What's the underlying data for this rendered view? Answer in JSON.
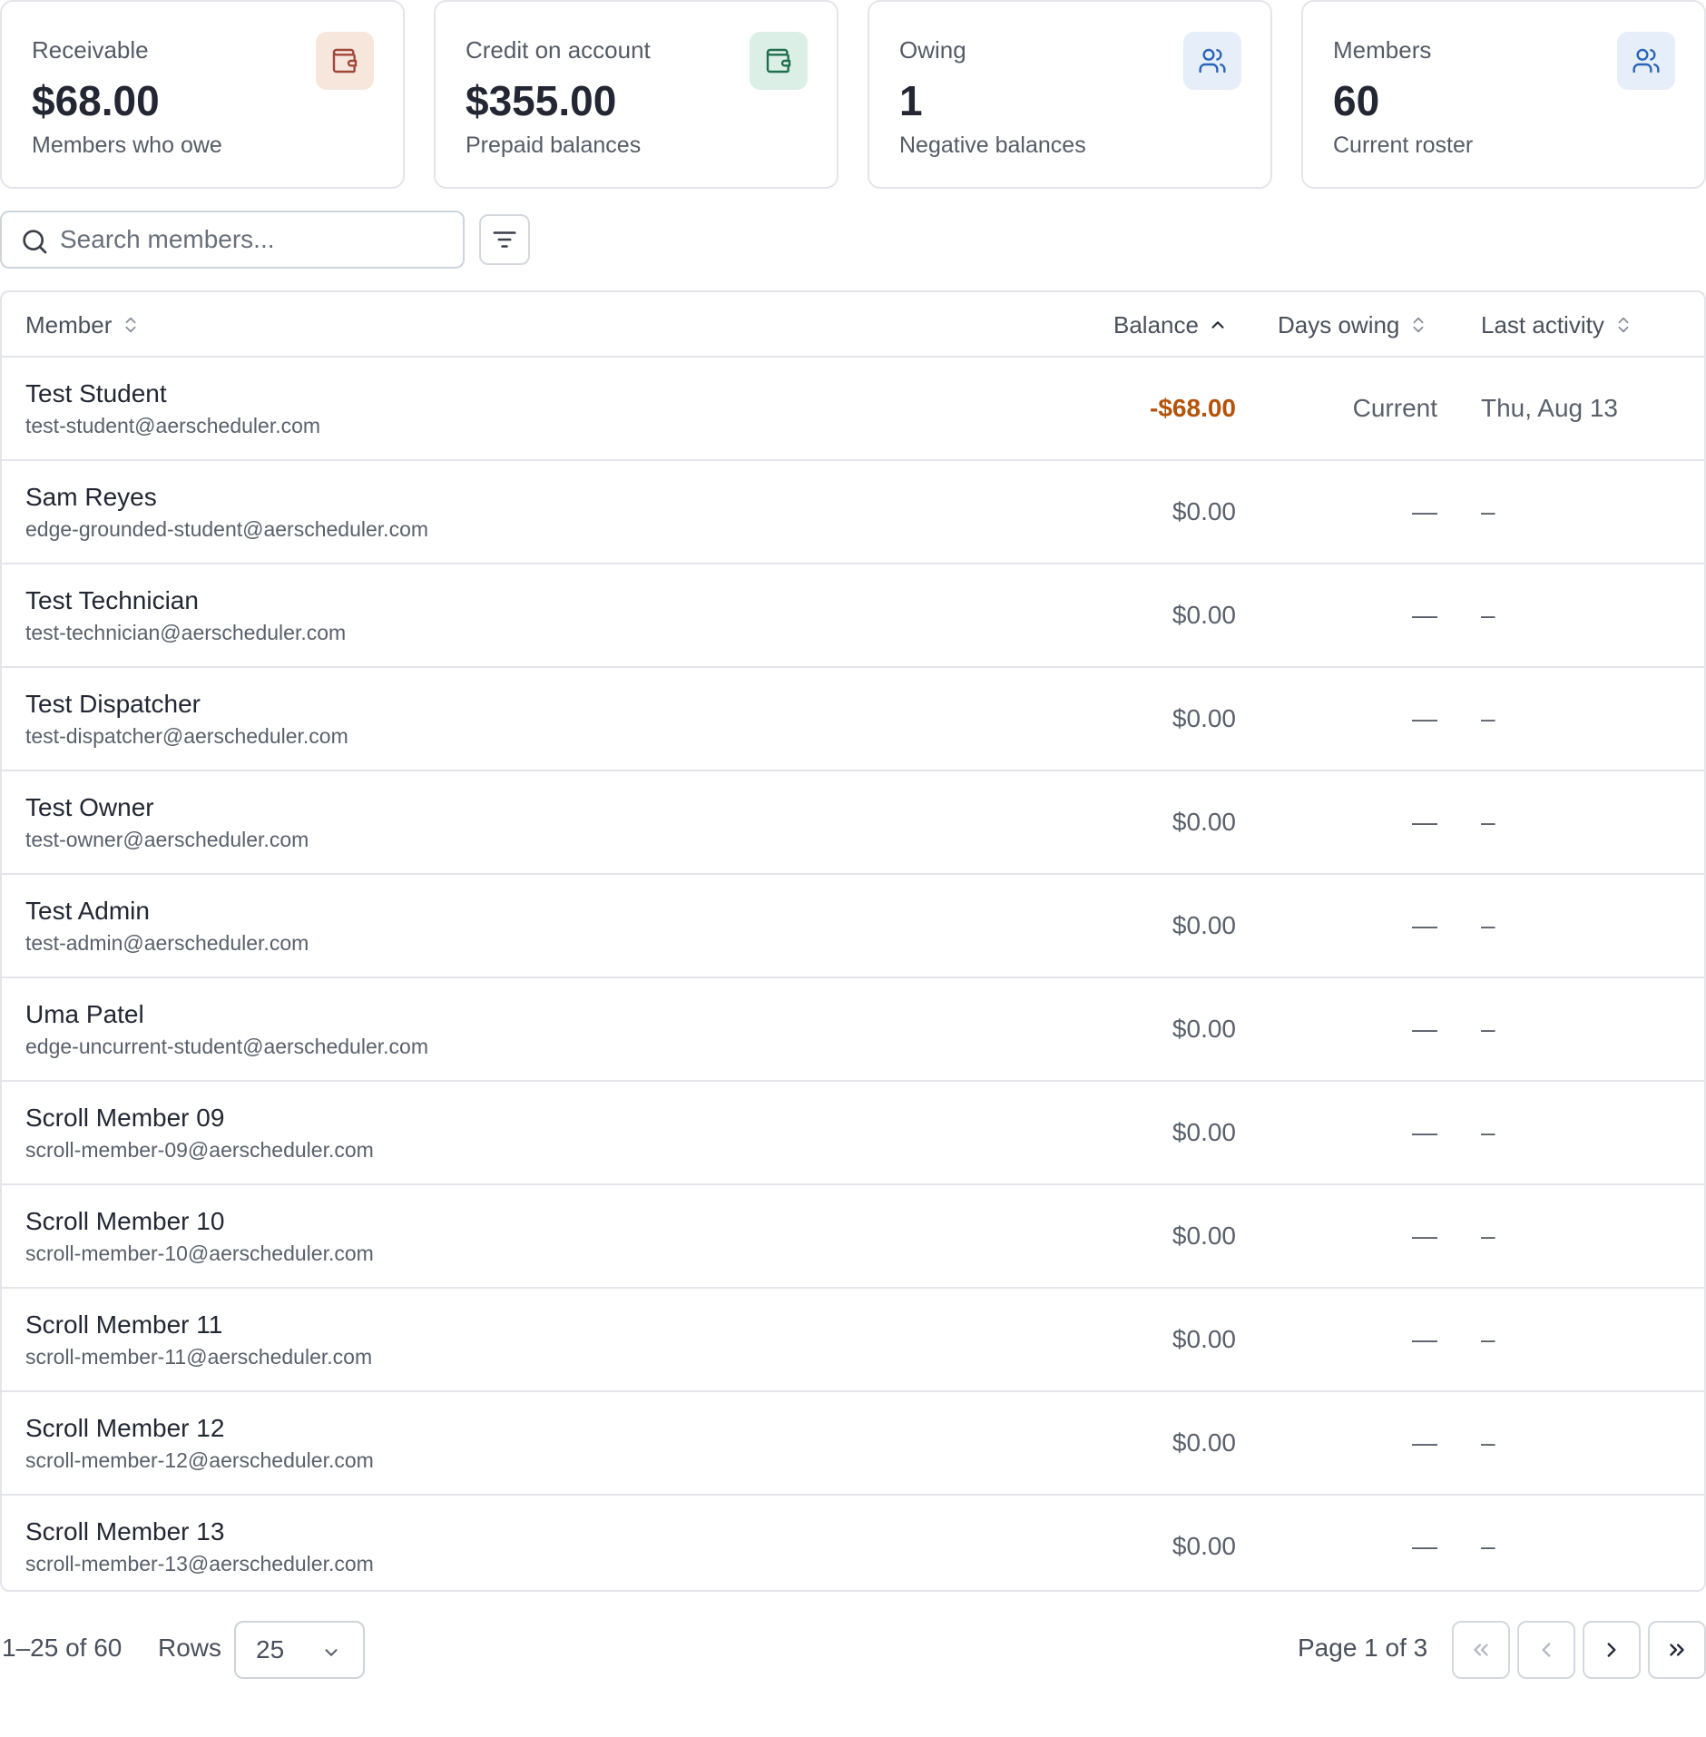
{
  "stats": [
    {
      "label": "Receivable",
      "value": "$68.00",
      "sub": "Members who owe",
      "icon": "wallet-icon",
      "icon_bg": "#f6e6dc",
      "icon_color": "#a2463a"
    },
    {
      "label": "Credit on account",
      "value": "$355.00",
      "sub": "Prepaid balances",
      "icon": "wallet-icon",
      "icon_bg": "#dcefe6",
      "icon_color": "#1f6f4f"
    },
    {
      "label": "Owing",
      "value": "1",
      "sub": "Negative balances",
      "icon": "users-icon",
      "icon_bg": "#e6eef9",
      "icon_color": "#2a64b8"
    },
    {
      "label": "Members",
      "value": "60",
      "sub": "Current roster",
      "icon": "users-icon",
      "icon_bg": "#e6eef9",
      "icon_color": "#2a64b8"
    }
  ],
  "search": {
    "placeholder": "Search members..."
  },
  "table": {
    "headers": {
      "member": "Member",
      "balance": "Balance",
      "days_owing": "Days owing",
      "last_activity": "Last activity"
    },
    "sort": {
      "column": "Balance",
      "direction": "ascending"
    },
    "rows": [
      {
        "name": "Test Student",
        "email": "test-student@aerscheduler.com",
        "balance": "-$68.00",
        "days": "Current",
        "last": "Thu, Aug 13"
      },
      {
        "name": "Sam Reyes",
        "email": "edge-grounded-student@aerscheduler.com",
        "balance": "$0.00",
        "days": "—",
        "last": "–"
      },
      {
        "name": "Test Technician",
        "email": "test-technician@aerscheduler.com",
        "balance": "$0.00",
        "days": "—",
        "last": "–"
      },
      {
        "name": "Test Dispatcher",
        "email": "test-dispatcher@aerscheduler.com",
        "balance": "$0.00",
        "days": "—",
        "last": "–"
      },
      {
        "name": "Test Owner",
        "email": "test-owner@aerscheduler.com",
        "balance": "$0.00",
        "days": "—",
        "last": "–"
      },
      {
        "name": "Test Admin",
        "email": "test-admin@aerscheduler.com",
        "balance": "$0.00",
        "days": "—",
        "last": "–"
      },
      {
        "name": "Uma Patel",
        "email": "edge-uncurrent-student@aerscheduler.com",
        "balance": "$0.00",
        "days": "—",
        "last": "–"
      },
      {
        "name": "Scroll Member 09",
        "email": "scroll-member-09@aerscheduler.com",
        "balance": "$0.00",
        "days": "—",
        "last": "–"
      },
      {
        "name": "Scroll Member 10",
        "email": "scroll-member-10@aerscheduler.com",
        "balance": "$0.00",
        "days": "—",
        "last": "–"
      },
      {
        "name": "Scroll Member 11",
        "email": "scroll-member-11@aerscheduler.com",
        "balance": "$0.00",
        "days": "—",
        "last": "–"
      },
      {
        "name": "Scroll Member 12",
        "email": "scroll-member-12@aerscheduler.com",
        "balance": "$0.00",
        "days": "—",
        "last": "–"
      },
      {
        "name": "Scroll Member 13",
        "email": "scroll-member-13@aerscheduler.com",
        "balance": "$0.00",
        "days": "—",
        "last": "–"
      }
    ]
  },
  "pagination": {
    "range": "1–25 of 60",
    "rows_label": "Rows",
    "rows_value": "25",
    "page_label": "Page 1 of 3"
  },
  "colors": {
    "negative_balance": "#b4530b",
    "border": "#e3e5ea"
  }
}
